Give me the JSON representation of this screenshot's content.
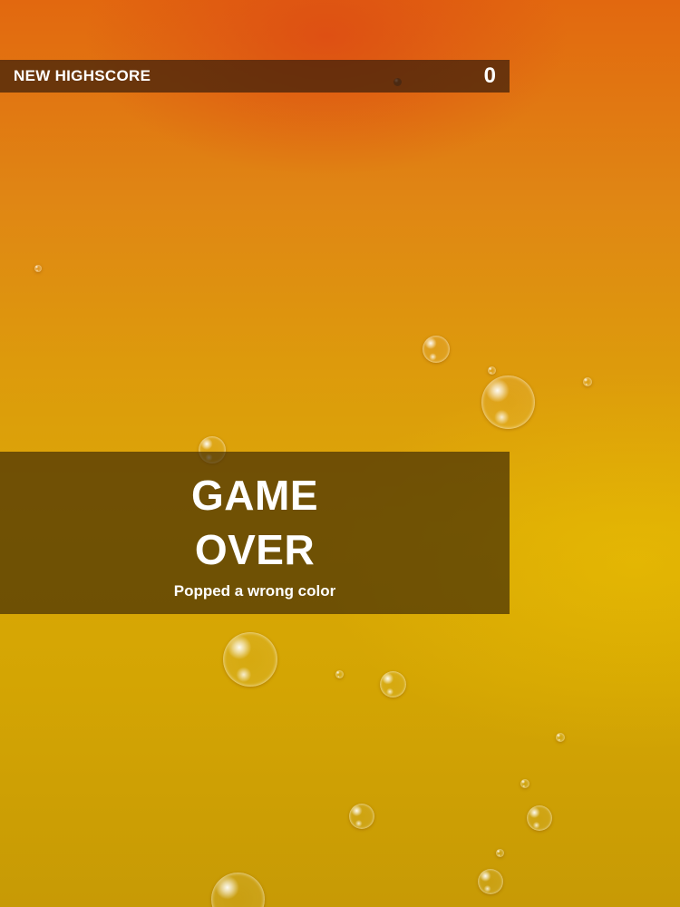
{
  "hud": {
    "highscore_label": "NEW HIGHSCORE",
    "score": "0"
  },
  "game_over": {
    "title_line1": "GAME",
    "title_line2": "OVER",
    "reason": "Popped a wrong color"
  },
  "colors": {
    "background_top": "#e2680f",
    "background_bottom": "#c79a05",
    "overlay": "#3c2805",
    "text": "#ffffff"
  },
  "icons": {
    "bubble": "bubble-icon"
  }
}
